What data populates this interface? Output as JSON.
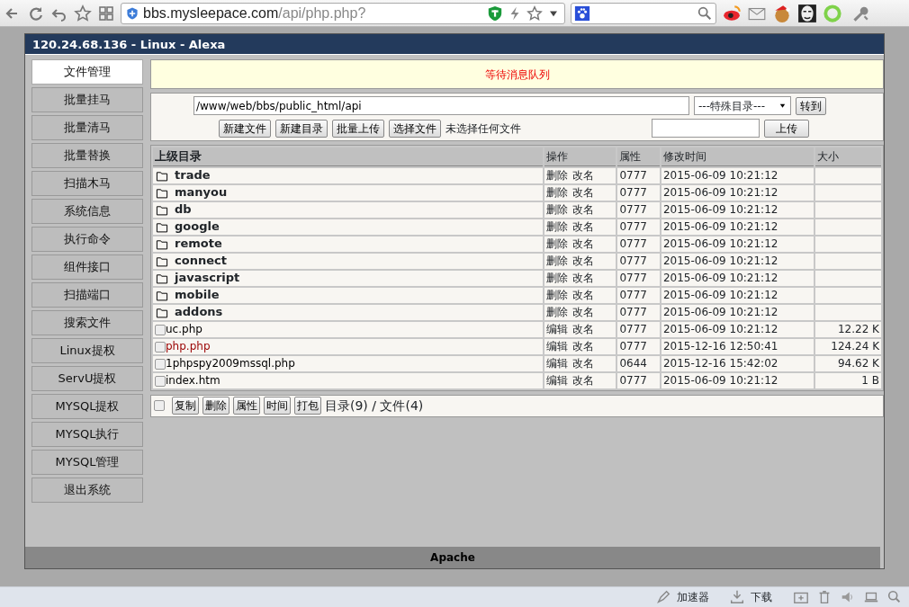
{
  "browser": {
    "url_host": "bbs.mysleepace.com",
    "url_path": "/api/php.php?"
  },
  "panel": {
    "title": "120.24.68.136 - Linux - Alexa",
    "footer": "Apache"
  },
  "sidebar": {
    "items": [
      {
        "label": "文件管理",
        "selected": true
      },
      {
        "label": "批量挂马",
        "selected": false
      },
      {
        "label": "批量清马",
        "selected": false
      },
      {
        "label": "批量替换",
        "selected": false
      },
      {
        "label": "扫描木马",
        "selected": false
      },
      {
        "label": "系统信息",
        "selected": false
      },
      {
        "label": "执行命令",
        "selected": false
      },
      {
        "label": "组件接口",
        "selected": false
      },
      {
        "label": "扫描端口",
        "selected": false
      },
      {
        "label": "搜索文件",
        "selected": false
      },
      {
        "label": "Linux提权",
        "selected": false
      },
      {
        "label": "ServU提权",
        "selected": false
      },
      {
        "label": "MYSQL提权",
        "selected": false
      },
      {
        "label": "MYSQL执行",
        "selected": false
      },
      {
        "label": "MYSQL管理",
        "selected": false
      },
      {
        "label": "退出系统",
        "selected": false
      }
    ]
  },
  "message": "等待消息队列",
  "path_form": {
    "path": "/www/web/bbs/public_html/api",
    "special_dir": "---特殊目录---",
    "go_button": "转到",
    "buttons": [
      "新建文件",
      "新建目录",
      "批量上传"
    ],
    "choose_file_button": "选择文件",
    "no_file_text": "未选择任何文件",
    "upload_button": "上传"
  },
  "table": {
    "columns": [
      "上级目录",
      "操作",
      "属性",
      "修改时间",
      "大小"
    ],
    "rows": [
      {
        "kind": "dir",
        "name": "trade",
        "actions": [
          "删除",
          "改名"
        ],
        "perm": "0777",
        "modified": "2015-06-09 10:21:12"
      },
      {
        "kind": "dir",
        "name": "manyou",
        "actions": [
          "删除",
          "改名"
        ],
        "perm": "0777",
        "modified": "2015-06-09 10:21:12"
      },
      {
        "kind": "dir",
        "name": "db",
        "actions": [
          "删除",
          "改名"
        ],
        "perm": "0777",
        "modified": "2015-06-09 10:21:12"
      },
      {
        "kind": "dir",
        "name": "google",
        "actions": [
          "删除",
          "改名"
        ],
        "perm": "0777",
        "modified": "2015-06-09 10:21:12"
      },
      {
        "kind": "dir",
        "name": "remote",
        "actions": [
          "删除",
          "改名"
        ],
        "perm": "0777",
        "modified": "2015-06-09 10:21:12"
      },
      {
        "kind": "dir",
        "name": "connect",
        "actions": [
          "删除",
          "改名"
        ],
        "perm": "0777",
        "modified": "2015-06-09 10:21:12"
      },
      {
        "kind": "dir",
        "name": "javascript",
        "actions": [
          "删除",
          "改名"
        ],
        "perm": "0777",
        "modified": "2015-06-09 10:21:12"
      },
      {
        "kind": "dir",
        "name": "mobile",
        "actions": [
          "删除",
          "改名"
        ],
        "perm": "0777",
        "modified": "2015-06-09 10:21:12"
      },
      {
        "kind": "dir",
        "name": "addons",
        "actions": [
          "删除",
          "改名"
        ],
        "perm": "0777",
        "modified": "2015-06-09 10:21:12"
      },
      {
        "kind": "file",
        "name": "uc.php",
        "checked": false,
        "color": "#000000",
        "actions": [
          "编辑",
          "改名"
        ],
        "perm": "0777",
        "modified": "2015-06-09 10:21:12",
        "size": "12.22 K"
      },
      {
        "kind": "file",
        "name": "php.php",
        "checked": false,
        "color": "#990000",
        "actions": [
          "编辑",
          "改名"
        ],
        "perm": "0777",
        "modified": "2015-12-16 12:50:41",
        "size": "124.24 K"
      },
      {
        "kind": "file",
        "name": "1phpspy2009mssql.php",
        "checked": false,
        "color": "#000000",
        "actions": [
          "编辑",
          "改名"
        ],
        "perm": "0644",
        "modified": "2015-12-16 15:42:02",
        "size": "94.62 K"
      },
      {
        "kind": "file",
        "name": "index.htm",
        "checked": false,
        "color": "#000000",
        "actions": [
          "编辑",
          "改名"
        ],
        "perm": "0777",
        "modified": "2015-06-09 10:21:12",
        "size": "1 B"
      }
    ]
  },
  "bulk": {
    "checked": false,
    "buttons": [
      "复制",
      "删除",
      "属性",
      "时间",
      "打包"
    ],
    "summary": "目录(9) / 文件(4)"
  },
  "status_bar": {
    "items": [
      "加速器",
      "下载"
    ]
  }
}
